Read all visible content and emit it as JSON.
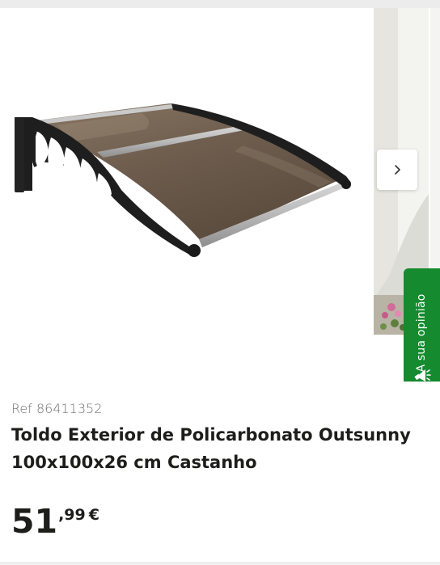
{
  "product": {
    "ref": "Ref 86411352",
    "title": "Toldo Exterior de Policarbonato Outsunny 100x100x26 cm Castanho",
    "price": {
      "integer": "51",
      "decimal": ",99",
      "currency": "€"
    }
  },
  "gallery": {
    "main_image": "awning-image",
    "next_icon": "chevron-right-icon"
  },
  "feedback": {
    "label": "A sua opinião",
    "icon": "megaphone-icon",
    "color": "#158a2f"
  },
  "colors": {
    "accent": "#158a2f",
    "text": "#1d1d1b",
    "muted": "#6f6f6f"
  }
}
